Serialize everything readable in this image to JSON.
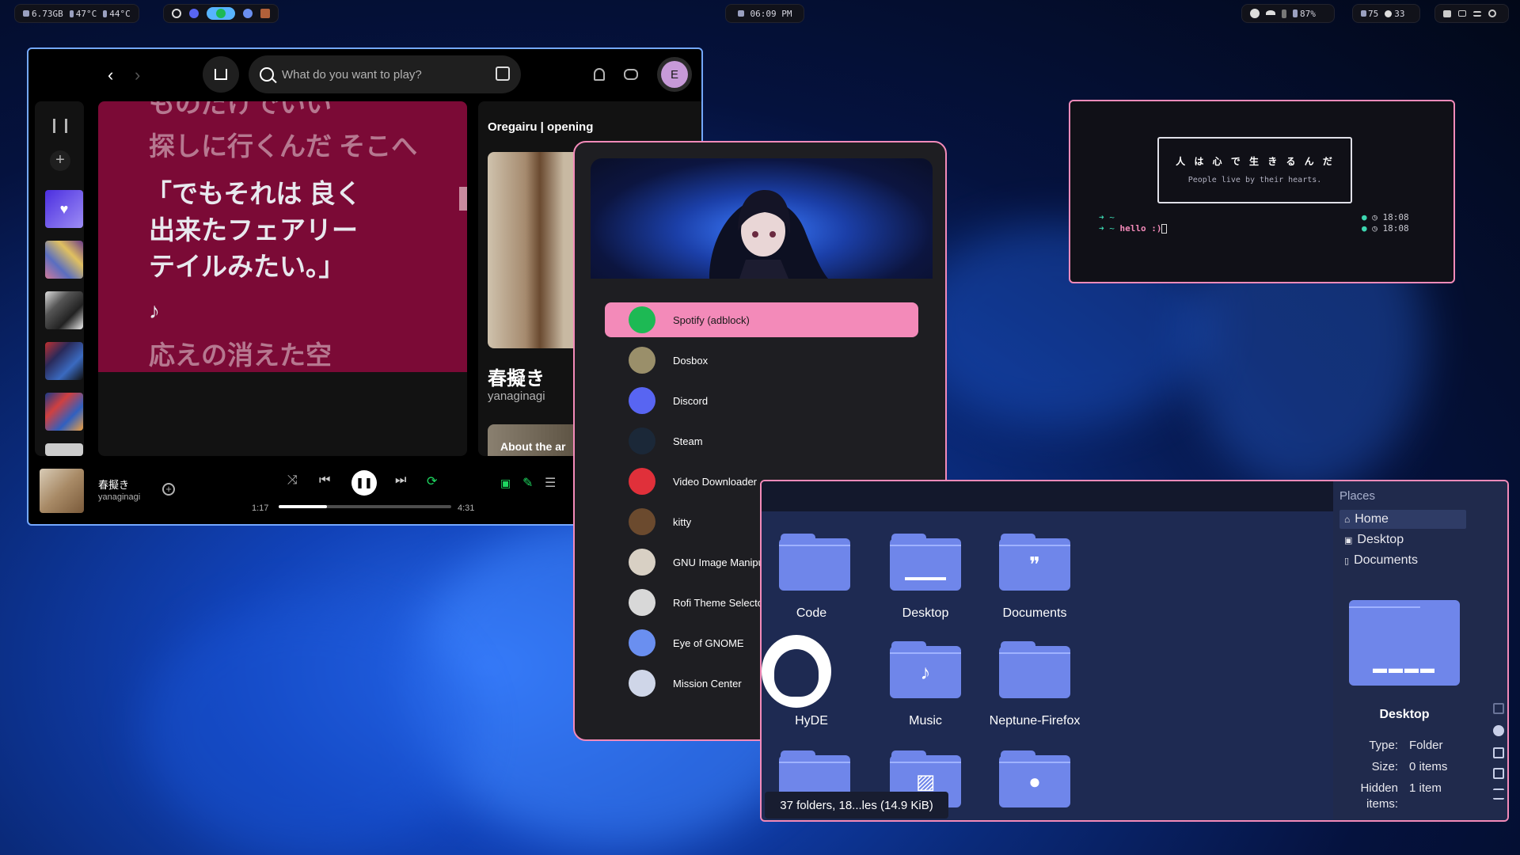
{
  "topbar": {
    "memory": "6.73GB",
    "temp_cpu": "47°C",
    "temp_gpu": "44°C",
    "clock": "06:09 PM",
    "battery": "87%",
    "volume": "75",
    "brightness": "33"
  },
  "spotify": {
    "search_placeholder": "What do you want to play?",
    "avatar": "E",
    "lyrics_lines": [
      "ものだけでいい",
      "探しに行くんだ そこへ",
      "「でもそれは 良く",
      "出来たフェアリー",
      "テイルみたい。」",
      "♪",
      "応えの消えた空"
    ],
    "right_title": "Oregairu | opening",
    "song": "春擬き",
    "artist": "yanaginagi",
    "about": "About the ar",
    "elapsed": "1:17",
    "duration": "4:31",
    "progress_fraction": 0.28
  },
  "rofi": {
    "items": [
      {
        "label": "Spotify (adblock)",
        "icon": "spotify-icon",
        "color": "#1db954"
      },
      {
        "label": "Dosbox",
        "icon": "dosbox-icon",
        "color": "#9a8f6a"
      },
      {
        "label": "Discord",
        "icon": "discord-icon",
        "color": "#5865f2"
      },
      {
        "label": "Steam",
        "icon": "steam-icon",
        "color": "#1b2838"
      },
      {
        "label": "Video Downloader",
        "icon": "video-downloader-icon",
        "color": "#e0303a"
      },
      {
        "label": "kitty",
        "icon": "kitty-icon",
        "color": "#6b4a2e"
      },
      {
        "label": "GNU Image Manipulation Program",
        "icon": "gimp-icon",
        "color": "#d8d0c4"
      },
      {
        "label": "Rofi Theme Selector",
        "icon": "rofi-theme-icon",
        "color": "#d8d8d8"
      },
      {
        "label": "Eye of GNOME",
        "icon": "eog-icon",
        "color": "#6a8ff0"
      },
      {
        "label": "Mission Center",
        "icon": "mission-center-icon",
        "color": "#cfd6e8"
      }
    ]
  },
  "terminal": {
    "quote_jp": "人 は 心 で 生 き る ん だ",
    "quote_en": "People live by their hearts.",
    "prompt1": "➜  ~",
    "prompt2": "➜  ~ ",
    "command": "hello :)",
    "time1": "18:08",
    "time2": "18:08"
  },
  "files": {
    "places_title": "Places",
    "places": [
      "Home",
      "Desktop",
      "Documents"
    ],
    "folders": [
      "Code",
      "Desktop",
      "Documents",
      "HyDE",
      "Music",
      "Neptune-Firefox"
    ],
    "preview_name": "Desktop",
    "type_label": "Type:",
    "type_value": "Folder",
    "size_label": "Size:",
    "size_value": "0 items",
    "hidden_label_1": "Hidden",
    "hidden_label_2": "items:",
    "hidden_value": "1 item",
    "status": "37 folders, 18...les (14.9 KiB)"
  }
}
